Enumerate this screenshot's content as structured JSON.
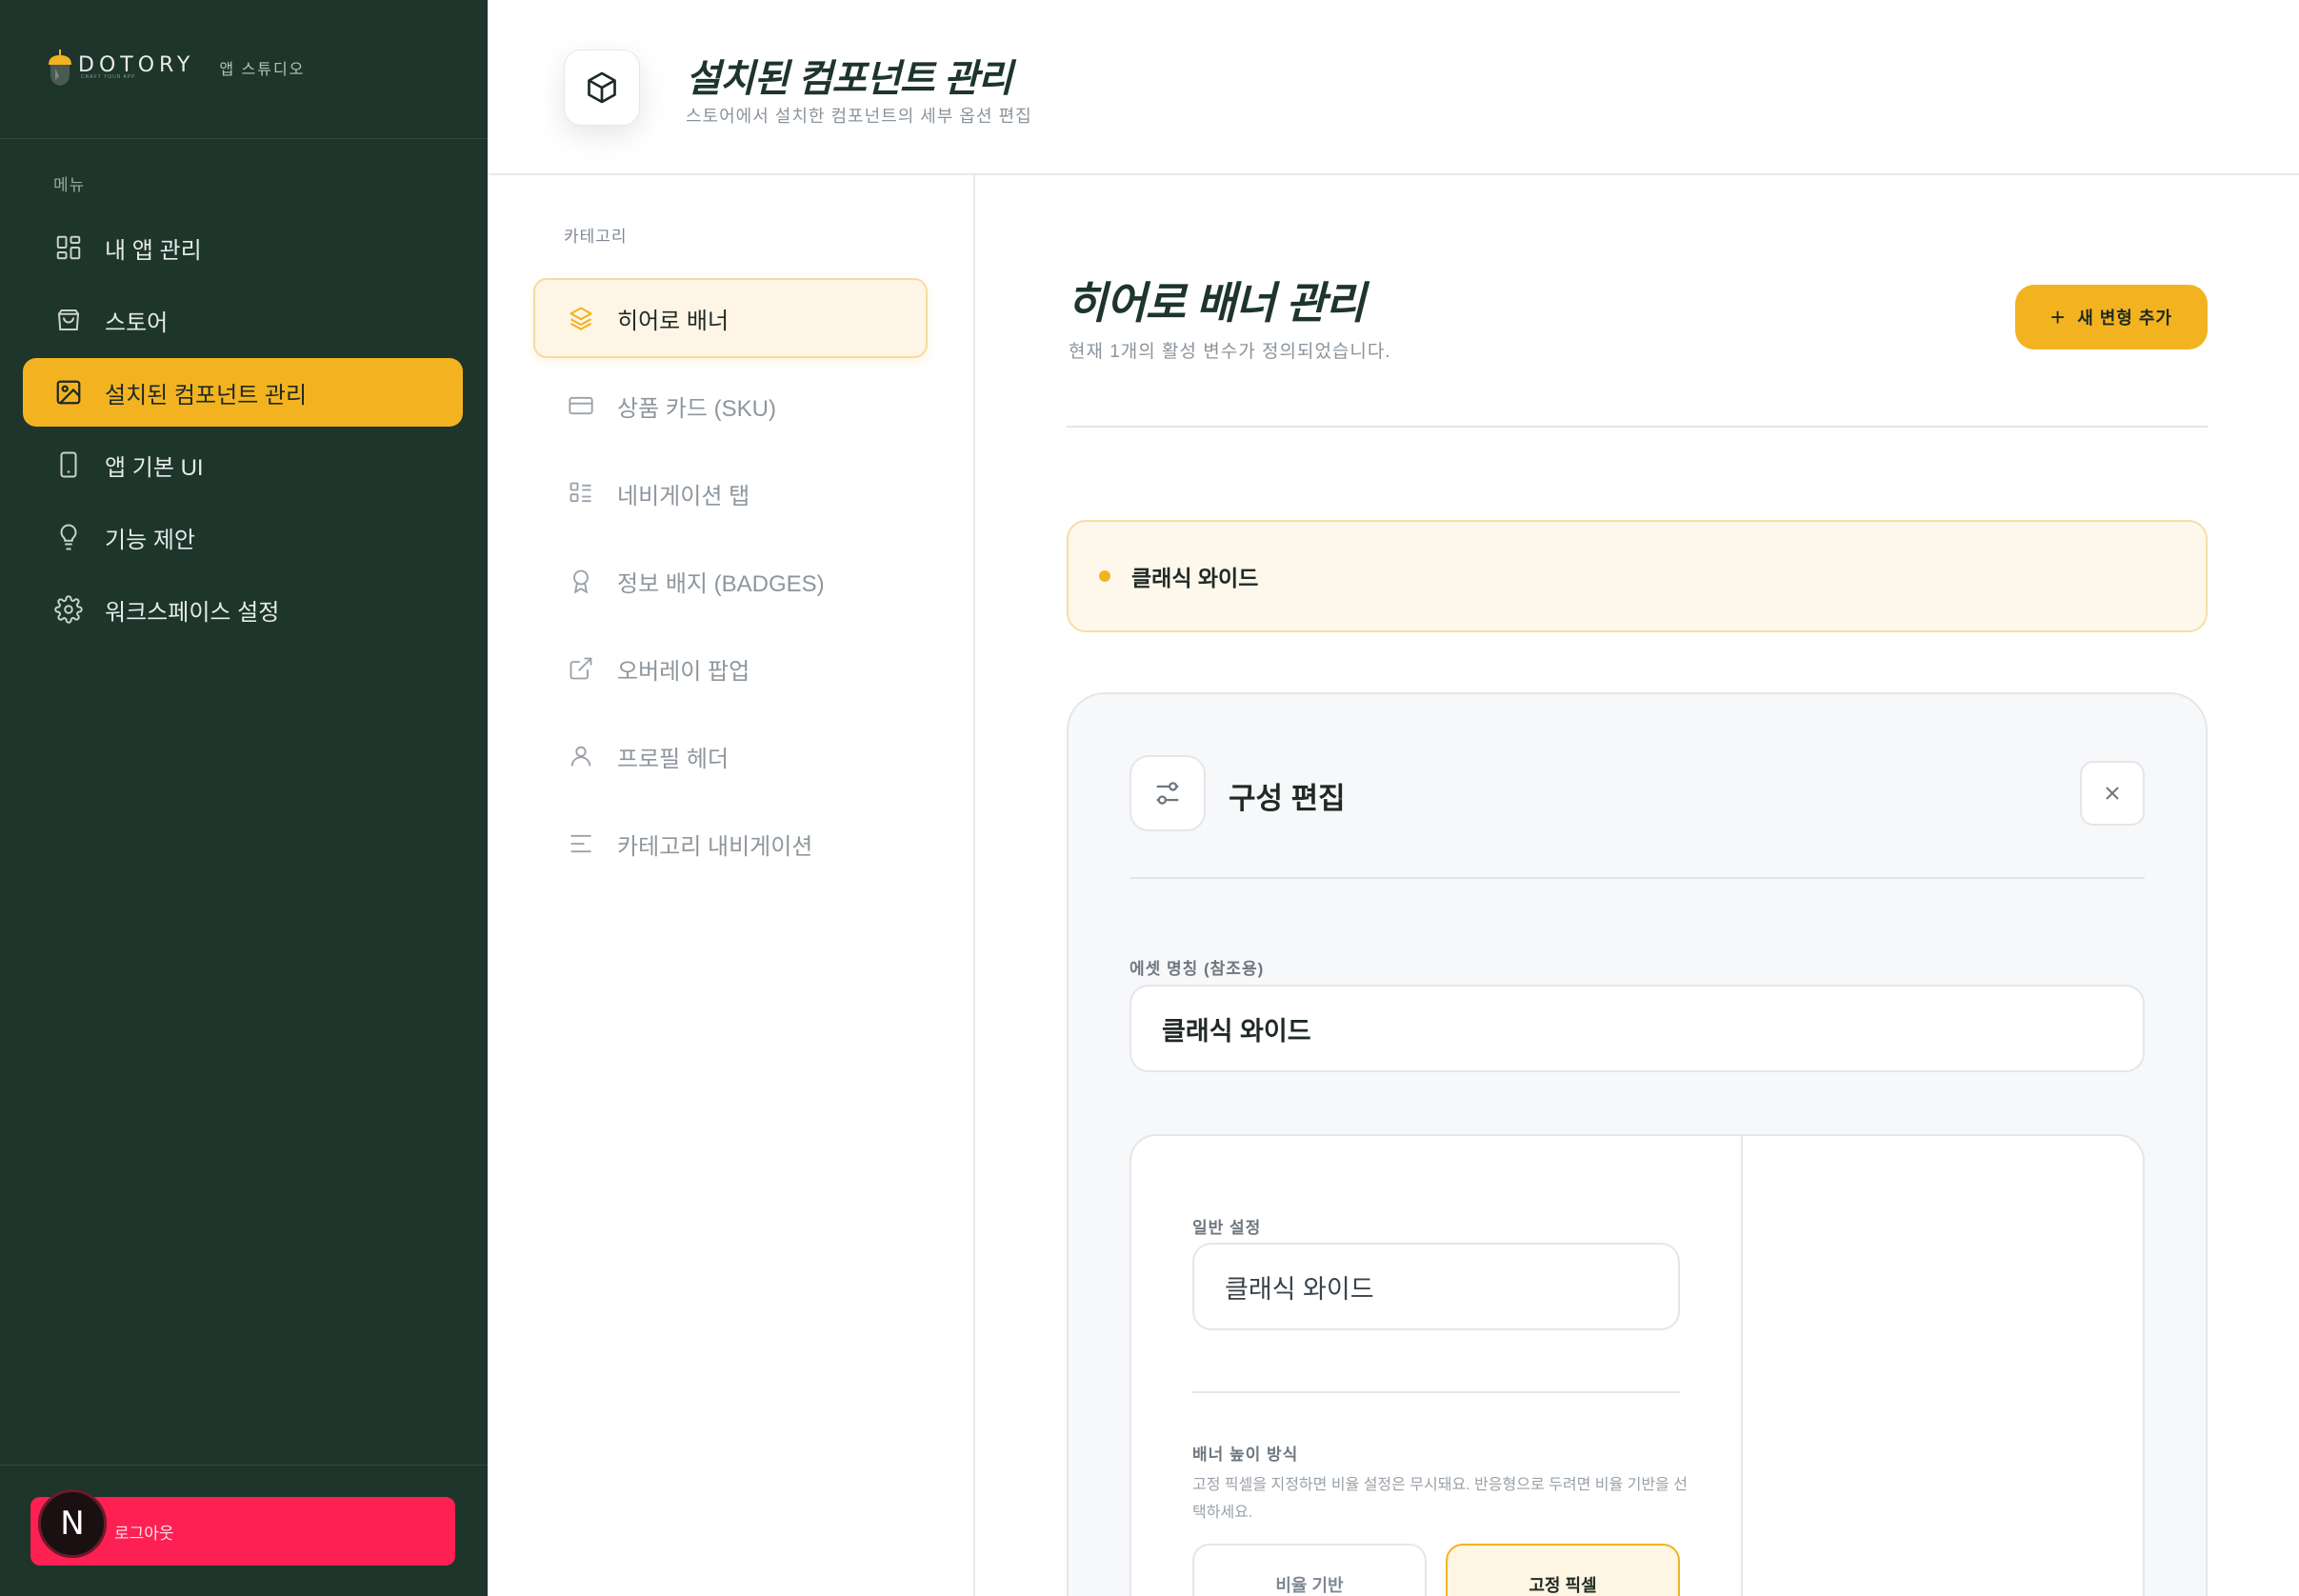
{
  "brand": {
    "name": "DOTORY",
    "tagline": "CRAFT YOUR APP",
    "subtitle": "앱 스튜디오"
  },
  "sidebar": {
    "menu_label": "메뉴",
    "items": [
      {
        "label": "내 앱 관리",
        "icon": "grid-icon"
      },
      {
        "label": "스토어",
        "icon": "shopping-bag-icon"
      },
      {
        "label": "설치된 컴포넌트 관리",
        "icon": "image-icon",
        "active": true
      },
      {
        "label": "앱 기본 UI",
        "icon": "smartphone-icon"
      },
      {
        "label": "기능 제안",
        "icon": "lightbulb-icon"
      },
      {
        "label": "워크스페이스 설정",
        "icon": "gear-icon"
      }
    ],
    "logout_label": "로그아웃",
    "avatar_letter": "N"
  },
  "header": {
    "title": "설치된 컴포넌트 관리",
    "subtitle": "스토어에서 설치한 컴포넌트의 세부 옵션 편집"
  },
  "categories": {
    "label": "카테고리",
    "items": [
      {
        "label": "히어로 배너",
        "icon": "layers-icon",
        "active": true
      },
      {
        "label": "상품 카드 (SKU)",
        "icon": "credit-card-icon"
      },
      {
        "label": "네비게이션 탭",
        "icon": "list-layout-icon"
      },
      {
        "label": "정보 배지 (BADGES)",
        "icon": "award-icon"
      },
      {
        "label": "오버레이 팝업",
        "icon": "external-link-icon"
      },
      {
        "label": "프로필 헤더",
        "icon": "user-icon"
      },
      {
        "label": "카테고리 내비게이션",
        "icon": "align-left-icon"
      }
    ]
  },
  "main": {
    "title": "히어로 배너 관리",
    "subtitle": "현재 1개의 활성 변수가 정의되었습니다.",
    "add_button": "새 변형 추가",
    "variants": [
      {
        "name": "클래식 와이드"
      }
    ]
  },
  "editor": {
    "title": "구성 편집",
    "asset_label": "에셋 명칭 (참조용)",
    "asset_value": "클래식 와이드",
    "general_label": "일반 설정",
    "general_value": "클래식 와이드",
    "height_label": "배너 높이 방식",
    "height_desc": "고정 픽셀을 지정하면 비율 설정은 무시돼요. 반응형으로 두려면 비율 기반을 선택하세요.",
    "mode_ratio": "비율 기반",
    "mode_fixed": "고정 픽셀",
    "selected_mode": "고정 픽셀"
  },
  "colors": {
    "sidebar_bg": "#1d352b",
    "accent": "#f3b321",
    "logout": "#fe1f53"
  }
}
